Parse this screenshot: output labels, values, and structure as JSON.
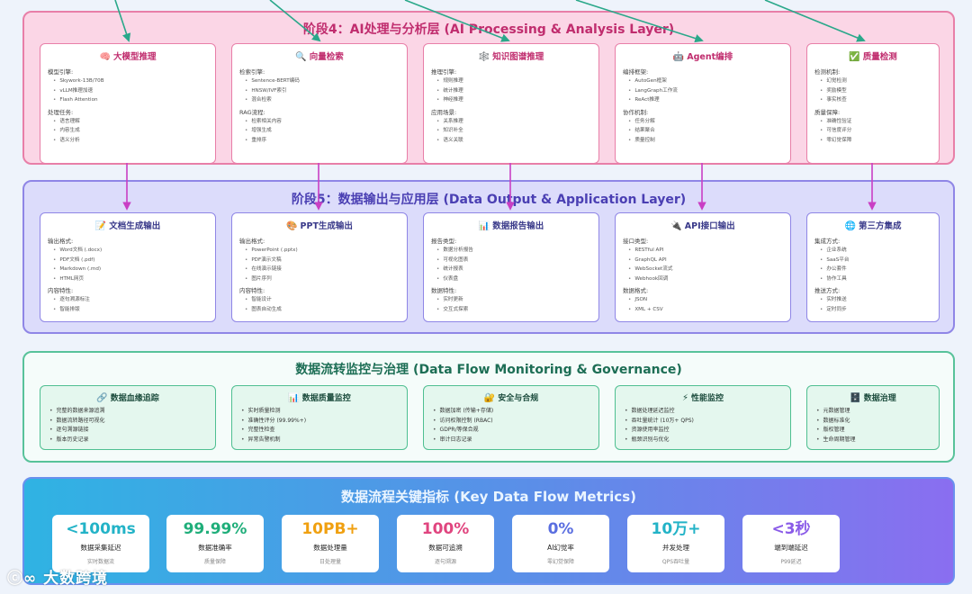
{
  "stage4": {
    "title": "阶段4：AI处理与分析层 (AI Processing & Analysis Layer)",
    "cards": [
      {
        "icon": "🧠",
        "title": "大模型推理",
        "sections": [
          {
            "label": "模型引擎:",
            "items": [
              "Skywork-13B/70B",
              "vLLM推理加速",
              "Flash Attention"
            ]
          },
          {
            "label": "处理任务:",
            "items": [
              "语言理解",
              "内容生成",
              "语义分析"
            ]
          }
        ]
      },
      {
        "icon": "🔍",
        "title": "向量检索",
        "sections": [
          {
            "label": "检索引擎:",
            "items": [
              "Sentence-BERT编码",
              "HNSW/IVF索引",
              "混合检索"
            ]
          },
          {
            "label": "RAG流程:",
            "items": [
              "检索相关内容",
              "增强生成",
              "重排序"
            ]
          }
        ]
      },
      {
        "icon": "🕸️",
        "title": "知识图谱推理",
        "sections": [
          {
            "label": "推理引擎:",
            "items": [
              "规则推理",
              "统计推理",
              "神经推理"
            ]
          },
          {
            "label": "应用场景:",
            "items": [
              "关系推理",
              "知识补全",
              "语义关联"
            ]
          }
        ]
      },
      {
        "icon": "🤖",
        "title": "Agent编排",
        "sections": [
          {
            "label": "编排框架:",
            "items": [
              "AutoGen框架",
              "LangGraph工作流",
              "ReAct推理"
            ]
          },
          {
            "label": "协作机制:",
            "items": [
              "任务分解",
              "结果聚合",
              "质量控制"
            ]
          }
        ]
      },
      {
        "icon": "✅",
        "title": "质量检测",
        "sections": [
          {
            "label": "检测机制:",
            "items": [
              "幻觉检测",
              "奖励模型",
              "事实核查"
            ]
          },
          {
            "label": "质量保障:",
            "items": [
              "准确性验证",
              "可信度评分",
              "零幻觉保障"
            ]
          }
        ]
      }
    ]
  },
  "stage5": {
    "title": "阶段5：数据输出与应用层 (Data Output & Application Layer)",
    "cards": [
      {
        "icon": "📝",
        "title": "文档生成输出",
        "sections": [
          {
            "label": "输出格式:",
            "items": [
              "Word文档 (.docx)",
              "PDF文档 (.pdf)",
              "Markdown (.md)",
              "HTML网页"
            ]
          },
          {
            "label": "内容特性:",
            "items": [
              "逐句溯源标注",
              "智能排版"
            ]
          }
        ]
      },
      {
        "icon": "🎨",
        "title": "PPT生成输出",
        "sections": [
          {
            "label": "输出格式:",
            "items": [
              "PowerPoint (.pptx)",
              "PDF演示文稿",
              "在线演示链接",
              "图片序列"
            ]
          },
          {
            "label": "内容特性:",
            "items": [
              "智能设计",
              "图表自动生成"
            ]
          }
        ]
      },
      {
        "icon": "📊",
        "title": "数据报告输出",
        "sections": [
          {
            "label": "报告类型:",
            "items": [
              "数据分析报告",
              "可视化图表",
              "统计报表",
              "仪表盘"
            ]
          },
          {
            "label": "数据特性:",
            "items": [
              "实时更新",
              "交互式探索"
            ]
          }
        ]
      },
      {
        "icon": "🔌",
        "title": "API接口输出",
        "sections": [
          {
            "label": "接口类型:",
            "items": [
              "RESTful API",
              "GraphQL API",
              "WebSocket流式",
              "Webhook回调"
            ]
          },
          {
            "label": "数据格式:",
            "items": [
              "JSON",
              "XML + CSV"
            ]
          }
        ]
      },
      {
        "icon": "🌐",
        "title": "第三方集成",
        "sections": [
          {
            "label": "集成方式:",
            "items": [
              "企业系统",
              "SaaS平台",
              "办公套件",
              "协作工具"
            ]
          },
          {
            "label": "推送方式:",
            "items": [
              "实时推送",
              "定时同步"
            ]
          }
        ]
      }
    ]
  },
  "governance": {
    "title": "数据流转监控与治理 (Data Flow Monitoring & Governance)",
    "cards": [
      {
        "icon": "🔗",
        "title": "数据血缘追踪",
        "items": [
          "完整的数据来源追溯",
          "数据流转路径可视化",
          "逐句溯源链接",
          "版本历史记录"
        ]
      },
      {
        "icon": "📊",
        "title": "数据质量监控",
        "items": [
          "实时质量检测",
          "准确性评分 (99.99%+)",
          "完整性检查",
          "异常告警机制"
        ]
      },
      {
        "icon": "🔐",
        "title": "安全与合规",
        "items": [
          "数据加密 (传输+存储)",
          "访问权限控制 (RBAC)",
          "GDPR/等保合规",
          "审计日志记录"
        ]
      },
      {
        "icon": "⚡",
        "title": "性能监控",
        "items": [
          "数据处理延迟监控",
          "吞吐量统计 (10万+ QPS)",
          "资源使用率监控",
          "瓶颈识别与优化"
        ]
      },
      {
        "icon": "🗄️",
        "title": "数据治理",
        "items": [
          "元数据管理",
          "数据标准化",
          "版权管理",
          "生命周期管理"
        ]
      }
    ]
  },
  "metrics": {
    "title": "数据流程关键指标 (Key Data Flow Metrics)",
    "items": [
      {
        "value": "<100ms",
        "label": "数据采集延迟",
        "sub": "实时数据流",
        "color": "#23b3c7"
      },
      {
        "value": "99.99%",
        "label": "数据准确率",
        "sub": "质量保障",
        "color": "#1fae7a"
      },
      {
        "value": "10PB+",
        "label": "数据处理量",
        "sub": "日处理量",
        "color": "#f0a010"
      },
      {
        "value": "100%",
        "label": "数据可追溯",
        "sub": "逐句溯源",
        "color": "#e0457f"
      },
      {
        "value": "0%",
        "label": "AI幻觉率",
        "sub": "零幻觉保障",
        "color": "#5a6ee0"
      },
      {
        "value": "10万+",
        "label": "并发处理",
        "sub": "QPS吞吐量",
        "color": "#23b3c7"
      },
      {
        "value": "<3秒",
        "label": "端到端延迟",
        "sub": "P99延迟",
        "color": "#8a5be8"
      }
    ]
  },
  "watermark": "大数跨境",
  "colors": {
    "stage4_border": "#e87fa8",
    "stage5_border": "#8f86e6",
    "governance_border": "#58c29a",
    "arrow_green": "#2aa88a",
    "arrow_magenta": "#c93fc4"
  }
}
